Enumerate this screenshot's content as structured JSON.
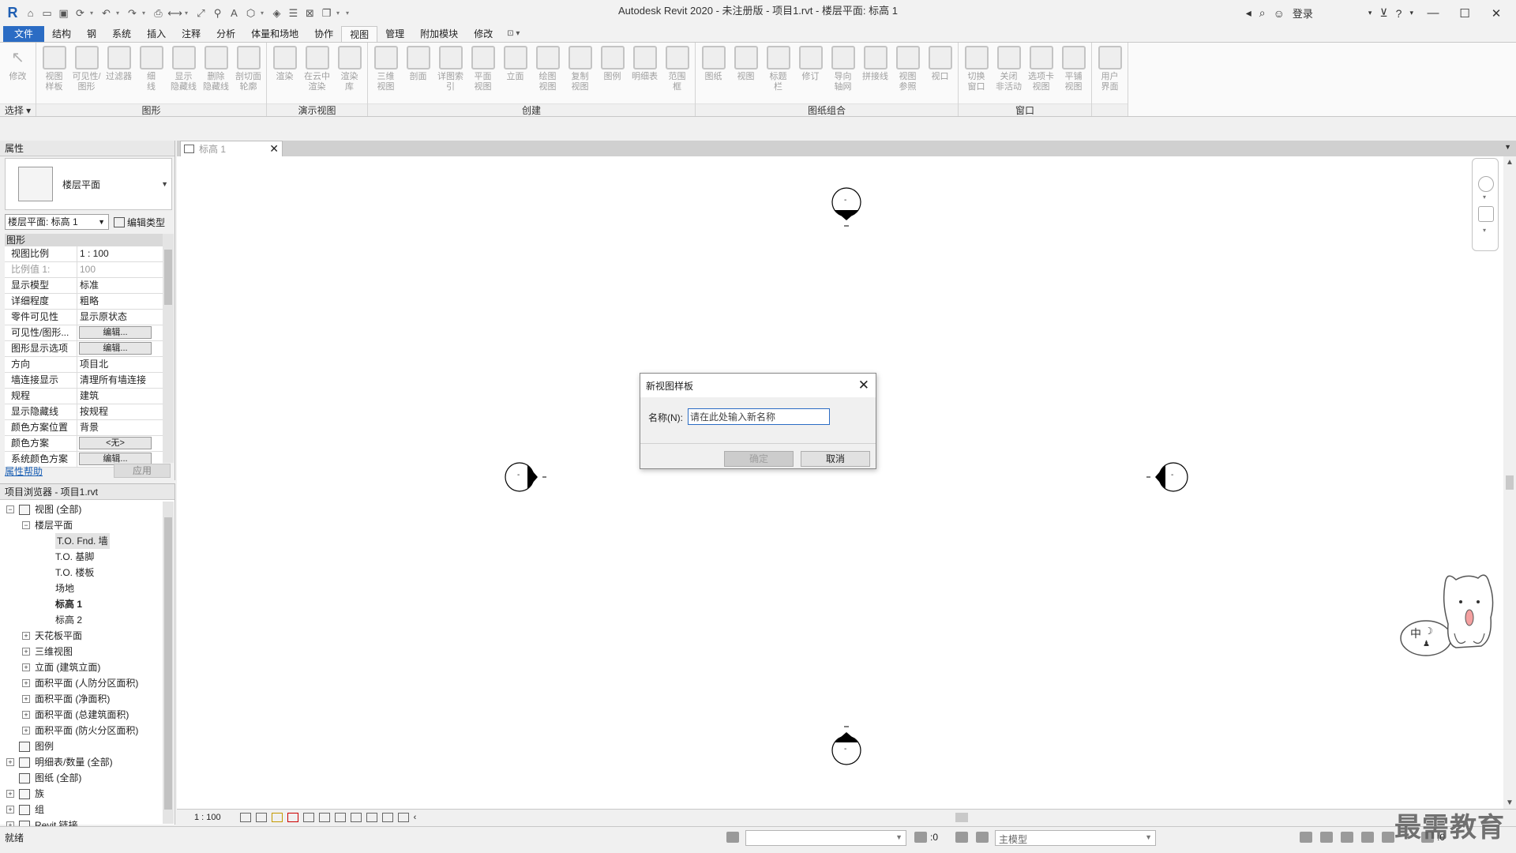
{
  "app": {
    "title": "Autodesk Revit 2020 - 未注册版 - 项目1.rvt - 楼层平面: 标高 1",
    "logo": "R",
    "login": "登录"
  },
  "ribbon": {
    "tabs": [
      "文件",
      "结构",
      "钢",
      "系统",
      "插入",
      "注释",
      "分析",
      "体量和场地",
      "协作",
      "视图",
      "管理",
      "附加模块",
      "修改"
    ],
    "active_tab": "视图",
    "groups": [
      {
        "label": "选择 ▾",
        "buttons": [
          "修改"
        ]
      },
      {
        "label": "图形",
        "buttons": [
          "视图\n样板",
          "可见性/\n图形",
          "过滤器",
          "细\n线",
          "显示\n隐藏线",
          "删除\n隐藏线",
          "剖切面\n轮廓"
        ]
      },
      {
        "label": "演示视图",
        "buttons": [
          "渲染",
          "在云中\n渲染",
          "渲染\n库"
        ]
      },
      {
        "label": "创建",
        "buttons": [
          "三维\n视图",
          "剖面",
          "详图索引",
          "平面\n视图",
          "立面",
          "绘图\n视图",
          "复制\n视图",
          "图例",
          "明细表",
          "范围\n框"
        ]
      },
      {
        "label": "图纸组合",
        "buttons": [
          "图纸",
          "视图",
          "标题\n栏",
          "修订",
          "导向\n轴网",
          "拼接线",
          "视图\n参照",
          "视口"
        ]
      },
      {
        "label": "窗口",
        "buttons": [
          "切换\n窗口",
          "关闭\n非活动",
          "选项卡\n视图",
          "平铺\n视图"
        ]
      },
      {
        "label": "",
        "buttons": [
          "用户\n界面"
        ]
      }
    ]
  },
  "properties": {
    "header": "属性",
    "type_name": "楼层平面",
    "type_selector": "楼层平面: 标高 1",
    "edit_type": "编辑类型",
    "category": "图形",
    "rows": [
      {
        "name": "视图比例",
        "value": "1 : 100"
      },
      {
        "name": "比例值 1:",
        "value": "100"
      },
      {
        "name": "显示模型",
        "value": "标准"
      },
      {
        "name": "详细程度",
        "value": "粗略"
      },
      {
        "name": "零件可见性",
        "value": "显示原状态"
      },
      {
        "name": "可见性/图形...",
        "value": "编辑..."
      },
      {
        "name": "图形显示选项",
        "value": "编辑..."
      },
      {
        "name": "方向",
        "value": "项目北"
      },
      {
        "name": "墙连接显示",
        "value": "清理所有墙连接"
      },
      {
        "name": "规程",
        "value": "建筑"
      },
      {
        "name": "显示隐藏线",
        "value": "按规程"
      },
      {
        "name": "颜色方案位置",
        "value": "背景"
      },
      {
        "name": "颜色方案",
        "value": "<无>"
      },
      {
        "name": "系统颜色方案",
        "value": "编辑..."
      }
    ],
    "help_link": "属性帮助",
    "apply": "应用"
  },
  "browser": {
    "header": "项目浏览器 - 项目1.rvt",
    "nodes": [
      {
        "label": "视图 (全部)"
      },
      {
        "label": "楼层平面"
      },
      {
        "label": "T.O. Fnd. 墙"
      },
      {
        "label": "T.O. 基脚"
      },
      {
        "label": "T.O. 楼板"
      },
      {
        "label": "场地"
      },
      {
        "label": "标高 1"
      },
      {
        "label": "标高 2"
      },
      {
        "label": "天花板平面"
      },
      {
        "label": "三维视图"
      },
      {
        "label": "立面 (建筑立面)"
      },
      {
        "label": "面积平面 (人防分区面积)"
      },
      {
        "label": "面积平面 (净面积)"
      },
      {
        "label": "面积平面 (总建筑面积)"
      },
      {
        "label": "面积平面 (防火分区面积)"
      },
      {
        "label": "图例"
      },
      {
        "label": "明细表/数量 (全部)"
      },
      {
        "label": "图纸 (全部)"
      },
      {
        "label": "族"
      },
      {
        "label": "组"
      },
      {
        "label": "Revit 链接"
      }
    ]
  },
  "view": {
    "tab_label": "标高 1",
    "scale": "1 : 100",
    "elevation_mark_text": "-"
  },
  "dialog": {
    "title": "新视图样板",
    "name_label": "名称(N):",
    "name_value": "请在此处输入新名称",
    "ok": "确定",
    "cancel": "取消"
  },
  "statusbar": {
    "text": "就绪",
    "zero_a": ":0",
    "model": "主模型",
    "zero_b": ":0"
  },
  "mascot": {
    "ime_label": "中"
  },
  "watermark": "最需教育",
  "colors": {
    "accent": "#2b6cc4",
    "file_tab": "#2b6cc4"
  }
}
